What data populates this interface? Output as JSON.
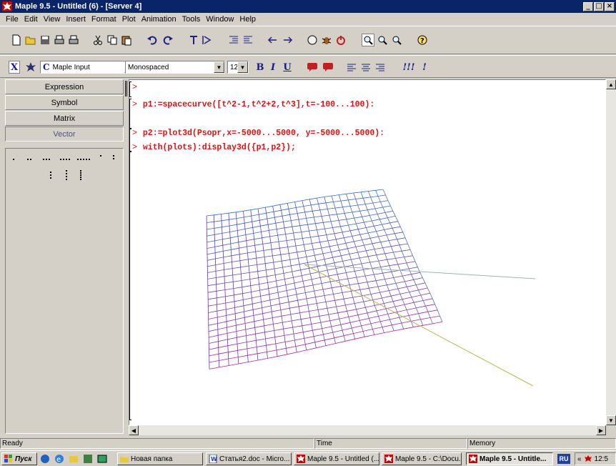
{
  "window": {
    "title": "Maple 9.5 - Untitled (6) - [Server 4]",
    "minimize": "_",
    "maximize": "□",
    "close": "×"
  },
  "menu": [
    "File",
    "Edit",
    "View",
    "Insert",
    "Format",
    "Plot",
    "Animation",
    "Tools",
    "Window",
    "Help"
  ],
  "toolbar2": {
    "mode_x": "X",
    "input_mode": "Maple Input",
    "font": "Monospaced",
    "size": "12",
    "bold": "B",
    "italic": "I",
    "underline": "U",
    "exec1": "!!!",
    "exec2": "!"
  },
  "palette": {
    "buttons": [
      "Expression",
      "Symbol",
      "Matrix",
      "Vector"
    ],
    "active": "Vector"
  },
  "worksheet": {
    "prompt": ">",
    "lines": [
      "",
      "p1:=spacecurve([t^2-1,t^2+2,t^3],t=-100...100):",
      "p2:=plot3d(Psopr,x=-5000...5000, y=-5000...5000):",
      "with(plots):display3d({p1,p2});"
    ]
  },
  "status": {
    "ready": "Ready",
    "time": "Time",
    "memory": "Memory"
  },
  "taskbar": {
    "start": "Пуск",
    "tasks": [
      {
        "label": "Новая папка",
        "active": false
      },
      {
        "label": "Статья2.doc - Micro...",
        "active": false
      },
      {
        "label": "Maple 9.5 - Untitled (...",
        "active": false
      },
      {
        "label": "Maple 9.5 - C:\\Docu...",
        "active": false
      },
      {
        "label": "Maple 9.5 - Untitle...",
        "active": true
      }
    ],
    "lang": "RU",
    "clock": "12:5"
  },
  "colors": {
    "titlebar": "#0a246a",
    "code": "#e01010",
    "face": "#d4d0c8"
  }
}
